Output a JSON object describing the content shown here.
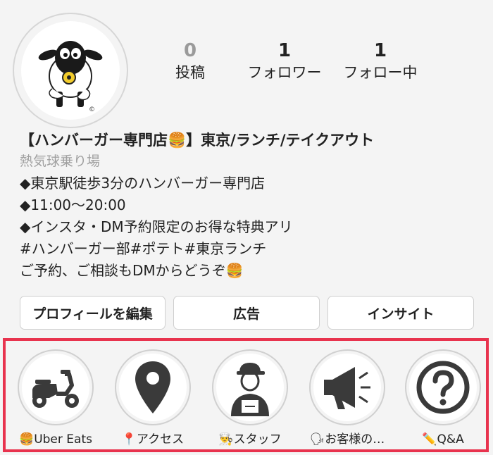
{
  "profile": {
    "stats": {
      "posts_count": "0",
      "posts_label": "投稿",
      "followers_count": "1",
      "followers_label": "フォロワー",
      "following_count": "1",
      "following_label": "フォロー中"
    },
    "name": "【ハンバーガー専門店🍔】東京/ランチ/テイクアウト",
    "category": "熱気球乗り場",
    "bio_lines": [
      "◆東京駅徒歩3分のハンバーガー専門店",
      "◆11:00〜20:00",
      "◆インスタ・DM予約限定のお得な特典アリ",
      "#ハンバーガー部#ポテト#東京ランチ",
      "ご予約、ご相談もDMからどうぞ🍔"
    ]
  },
  "buttons": {
    "edit_profile": "プロフィールを編集",
    "ads": "広告",
    "insights": "インサイト"
  },
  "highlights": [
    {
      "icon": "scooter-icon",
      "caption": "🍔Uber Eats"
    },
    {
      "icon": "map-pin-icon",
      "caption": "📍アクセス"
    },
    {
      "icon": "delivery-staff-icon",
      "caption": "👨‍🍳スタッフ"
    },
    {
      "icon": "megaphone-icon",
      "caption": "🗣お客様の…"
    },
    {
      "icon": "question-icon",
      "caption": "✏️Q&A"
    }
  ],
  "colors": {
    "highlight_frame": "#e8334e",
    "background": "#f4f4f4",
    "icon_dark": "#3a3a3a"
  }
}
